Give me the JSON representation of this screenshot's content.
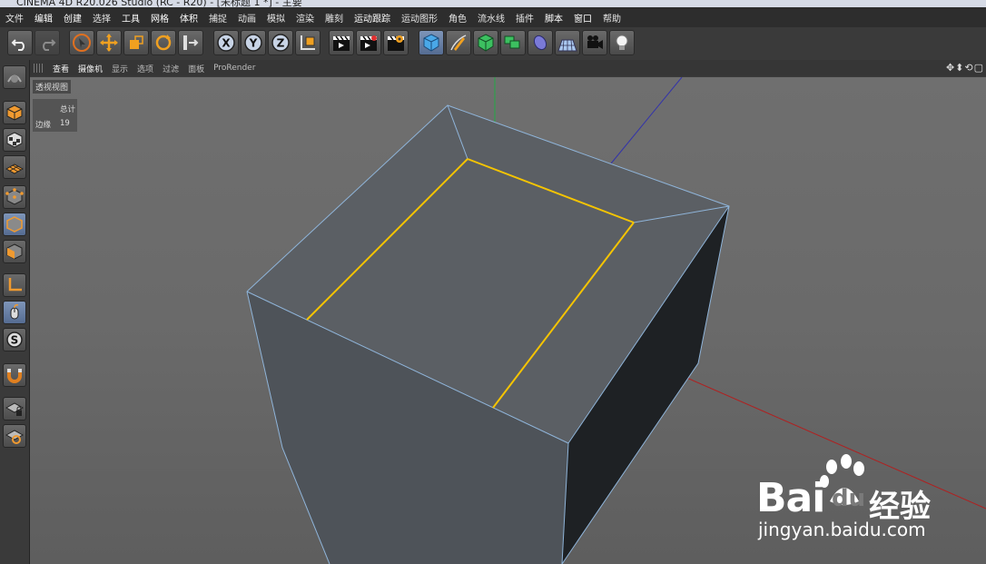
{
  "window": {
    "title": "CINEMA 4D R20.026 Studio (RC - R20) - [未标题 1 *] - 主要"
  },
  "menubar": [
    {
      "label": "文件"
    },
    {
      "label": "编辑"
    },
    {
      "label": "创建"
    },
    {
      "label": "选择"
    },
    {
      "label": "工具"
    },
    {
      "label": "网格"
    },
    {
      "label": "体积"
    },
    {
      "label": "捕捉"
    },
    {
      "label": "动画"
    },
    {
      "label": "模拟"
    },
    {
      "label": "渲染"
    },
    {
      "label": "雕刻"
    },
    {
      "label": "运动跟踪"
    },
    {
      "label": "运动图形"
    },
    {
      "label": "角色"
    },
    {
      "label": "流水线"
    },
    {
      "label": "插件"
    },
    {
      "label": "脚本"
    },
    {
      "label": "窗口"
    },
    {
      "label": "帮助"
    }
  ],
  "toolbar": {
    "undo_icon": "undo-icon",
    "redo_icon": "redo-icon",
    "axis_x": "X",
    "axis_y": "Y",
    "axis_z": "Z"
  },
  "viewport_menu": [
    {
      "label": "查看"
    },
    {
      "label": "摄像机"
    },
    {
      "label": "显示"
    },
    {
      "label": "选项"
    },
    {
      "label": "过滤"
    },
    {
      "label": "面板"
    },
    {
      "label": "ProRender"
    }
  ],
  "viewport": {
    "label": "透视视图",
    "hud": {
      "title": "总计",
      "key": "边缘",
      "value": "19"
    },
    "colors": {
      "face_top": "#5b5f64",
      "face_front": "#4e5359",
      "face_right": "#1e2124",
      "edge": "#8fb4d9",
      "selected_edge": "#f5c400",
      "axis_x": "#b02020",
      "axis_y": "#22aa44",
      "axis_z": "#3333aa"
    }
  },
  "watermark": {
    "brand_left": "Bai",
    "brand_right": "du",
    "brand_cn": "经验",
    "url": "jingyan.baidu.com"
  }
}
